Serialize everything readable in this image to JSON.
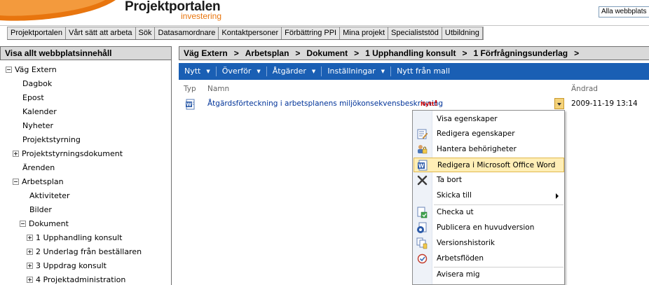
{
  "header": {
    "logo_title": "Projektportalen",
    "logo_subtitle": "investering",
    "search_scope": "Alla webbplats",
    "brand_color": "#e8750e"
  },
  "topnav": {
    "items": [
      "Projektportalen",
      "Vårt sätt att arbeta",
      "Sök",
      "Datasamordnare",
      "Kontaktpersoner",
      "Förbättring PPI",
      "Mina projekt",
      "Specialiststöd",
      "Utbildning"
    ]
  },
  "leftnav": {
    "header": "Visa allt webbplatsinnehåll",
    "items": [
      "Väg Extern",
      "Dagbok",
      "Epost",
      "Kalender",
      "Nyheter",
      "Projektstyrning",
      "Projektstyrningsdokument",
      "Ärenden",
      "Arbetsplan",
      "Aktiviteter",
      "Bilder",
      "Dokument",
      "1 Upphandling konsult",
      "2 Underlag från beställaren",
      "3 Uppdrag konsult",
      "4 Projektadministration"
    ]
  },
  "breadcrumb": {
    "items": [
      "Väg Extern",
      "Arbetsplan",
      "Dokument",
      "1 Upphandling konsult",
      "1 Förfrågningsunderlag"
    ],
    "separator": ">"
  },
  "toolbar": {
    "new": "Nytt",
    "upload": "Överför",
    "actions": "Åtgärder",
    "settings": "Inställningar",
    "new_from_template": "Nytt från mall",
    "color": "#1a5fb4"
  },
  "list": {
    "col_type": "Typ",
    "col_name": "Namn",
    "col_changed": "Ändrad",
    "rows": [
      {
        "name": "Åtgärdsförteckning i arbetsplanens miljökonsekvensbeskrivning",
        "badge": "Nytt",
        "changed": "2009-11-19 13:14",
        "icon": "word-document-icon"
      }
    ]
  },
  "context_menu": {
    "items": [
      "Visa egenskaper",
      "Redigera egenskaper",
      "Hantera behörigheter",
      "Redigera i Microsoft Office Word",
      "Ta bort",
      "Skicka till",
      "Checka ut",
      "Publicera en huvudversion",
      "Versionshistorik",
      "Arbetsflöden",
      "Avisera mig"
    ],
    "active_item": "Redigera i Microsoft Office Word",
    "highlight_color": "#ffeeb6"
  }
}
